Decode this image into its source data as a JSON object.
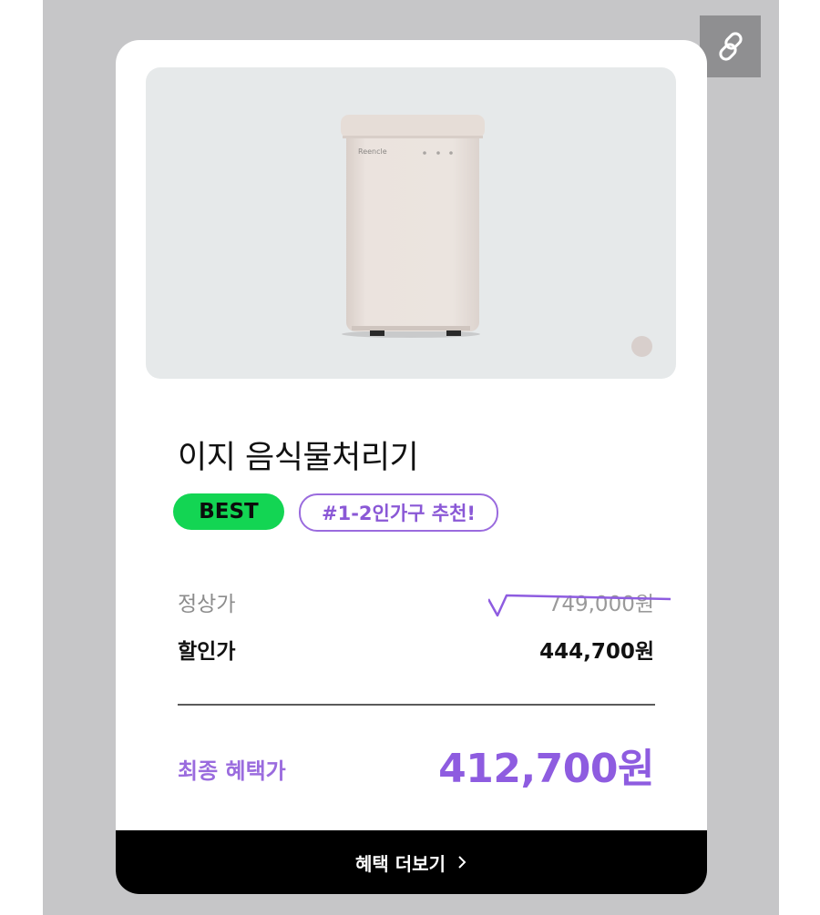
{
  "colors": {
    "best_badge": "#13d553",
    "accent_purple": "#8e5ce0",
    "cta_bg": "#000000",
    "share_bg": "#8f8f91"
  },
  "share": {
    "icon": "link-icon"
  },
  "product": {
    "image_brand_text": "Reencle",
    "name": "이지 음식물처리기",
    "badges": [
      "BEST",
      "#1-2인가구 추천!"
    ]
  },
  "pricing": {
    "regular_label": "정상가",
    "regular_price": "749,000원",
    "discount_label": "할인가",
    "discount_price": "444,700원",
    "final_label": "최종 혜택가",
    "final_price": "412,700원"
  },
  "cta": {
    "label": "혜택 더보기",
    "icon": "chevron-right-icon"
  }
}
